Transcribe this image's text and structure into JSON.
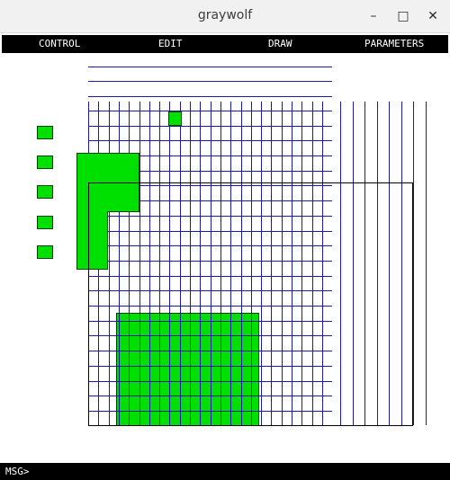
{
  "window": {
    "title": "graywolf",
    "minimize_glyph": "–",
    "maximize_glyph": "□",
    "close_glyph": "✕"
  },
  "menu": {
    "items": [
      {
        "label": "CONTROL"
      },
      {
        "label": "EDIT"
      },
      {
        "label": "DRAW"
      },
      {
        "label": "PARAMETERS"
      }
    ]
  },
  "message_bar": {
    "prompt": "MSG>"
  },
  "colors": {
    "grid_line": "#1a1aa6",
    "cell_fill": "#00e000",
    "cell_stroke": "#004000",
    "outline": "#000000",
    "menu_bg": "#000000",
    "menu_text": "#ffffff"
  }
}
